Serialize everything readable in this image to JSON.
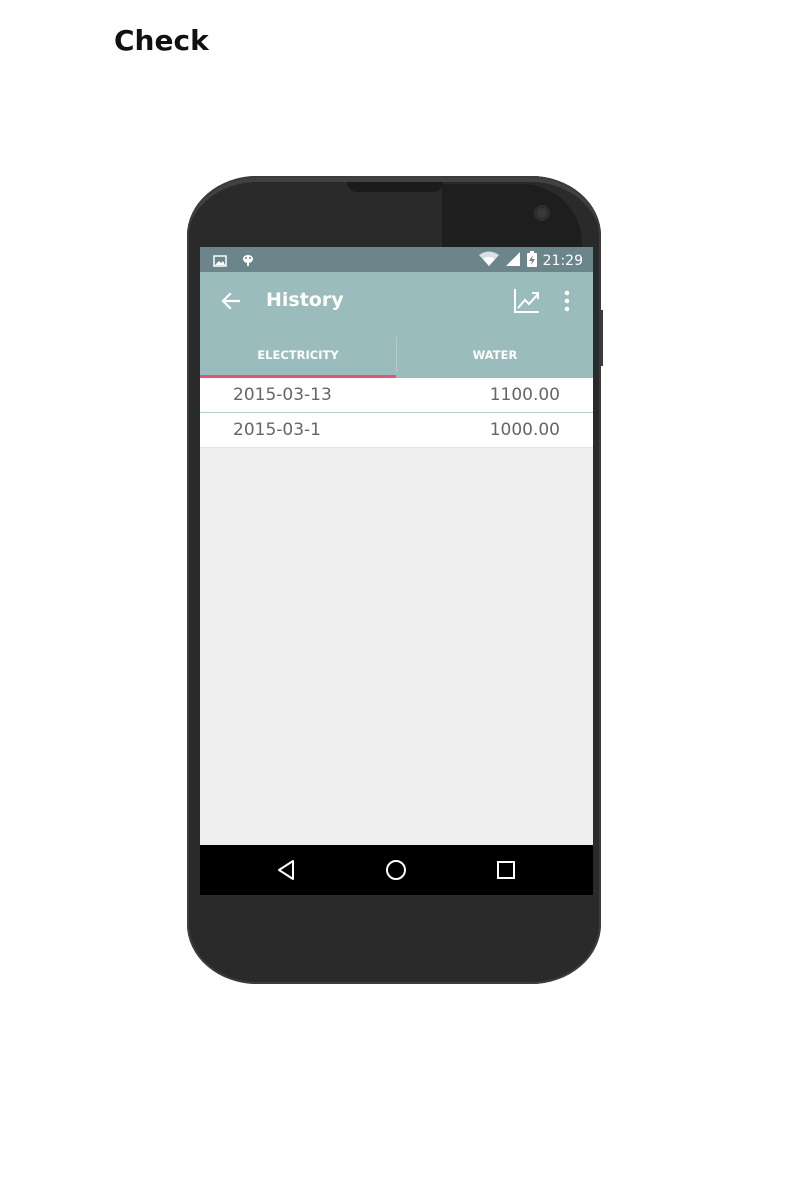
{
  "page": {
    "heading": "Check"
  },
  "status_bar": {
    "time": "21:29",
    "left_icons": [
      "image-icon",
      "android-debug-icon"
    ],
    "right_icons": [
      "wifi-icon",
      "signal-icon",
      "battery-charging-icon"
    ]
  },
  "app_bar": {
    "title": "History",
    "back_icon": "arrow-left-icon",
    "action_icons": [
      "chart-icon",
      "more-vert-icon"
    ]
  },
  "tabs": [
    {
      "label": "ELECTRICITY",
      "active": true
    },
    {
      "label": "WATER",
      "active": false
    }
  ],
  "history": {
    "rows": [
      {
        "date": "2015-03-13",
        "value": "1100.00"
      },
      {
        "date": "2015-03-1",
        "value": "1000.00"
      }
    ]
  },
  "nav_bar": {
    "icons": [
      "back-triangle-icon",
      "home-circle-icon",
      "recents-square-icon"
    ]
  },
  "colors": {
    "status_bar": "#6b858a",
    "app_bar": "#9bbcbc",
    "tab_indicator": "#e2567e",
    "list_background": "#eeeeee"
  }
}
